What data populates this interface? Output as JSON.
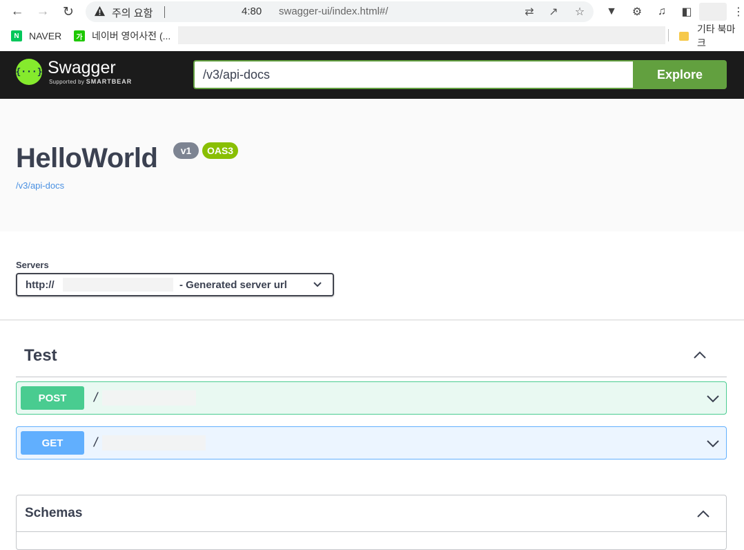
{
  "browser": {
    "security_warning": "주의 요함",
    "address_port": "4:80",
    "address_path": "swagger-ui/index.html#/",
    "bookmarks": [
      {
        "label": "NAVER",
        "favicon_letter": "N",
        "color": "#03c75a"
      },
      {
        "label": "네이버 영어사전 (...",
        "favicon_letter": "가",
        "color": "#1ec800"
      }
    ],
    "other_bookmarks": "기타 북마크"
  },
  "topbar": {
    "logo_title": "Swagger",
    "logo_supported": "Supported by",
    "logo_company": "SMARTBEAR",
    "logo_icon": "{···}",
    "url_value": "/v3/api-docs",
    "explore_label": "Explore"
  },
  "info": {
    "title": "HelloWorld",
    "version_badge": "v1",
    "spec_badge": "OAS3",
    "spec_link": "/v3/api-docs"
  },
  "servers": {
    "label": "Servers",
    "selected_scheme": "http://",
    "selected_description": "- Generated server url"
  },
  "tag": {
    "name": "Test",
    "operations": [
      {
        "method": "POST",
        "path": "/"
      },
      {
        "method": "GET",
        "path": "/"
      }
    ]
  },
  "schemas": {
    "title": "Schemas"
  },
  "colors": {
    "post": "#49cc90",
    "get": "#61affe",
    "swagger_green": "#62a03f",
    "topbar_bg": "#1b1b1b"
  }
}
